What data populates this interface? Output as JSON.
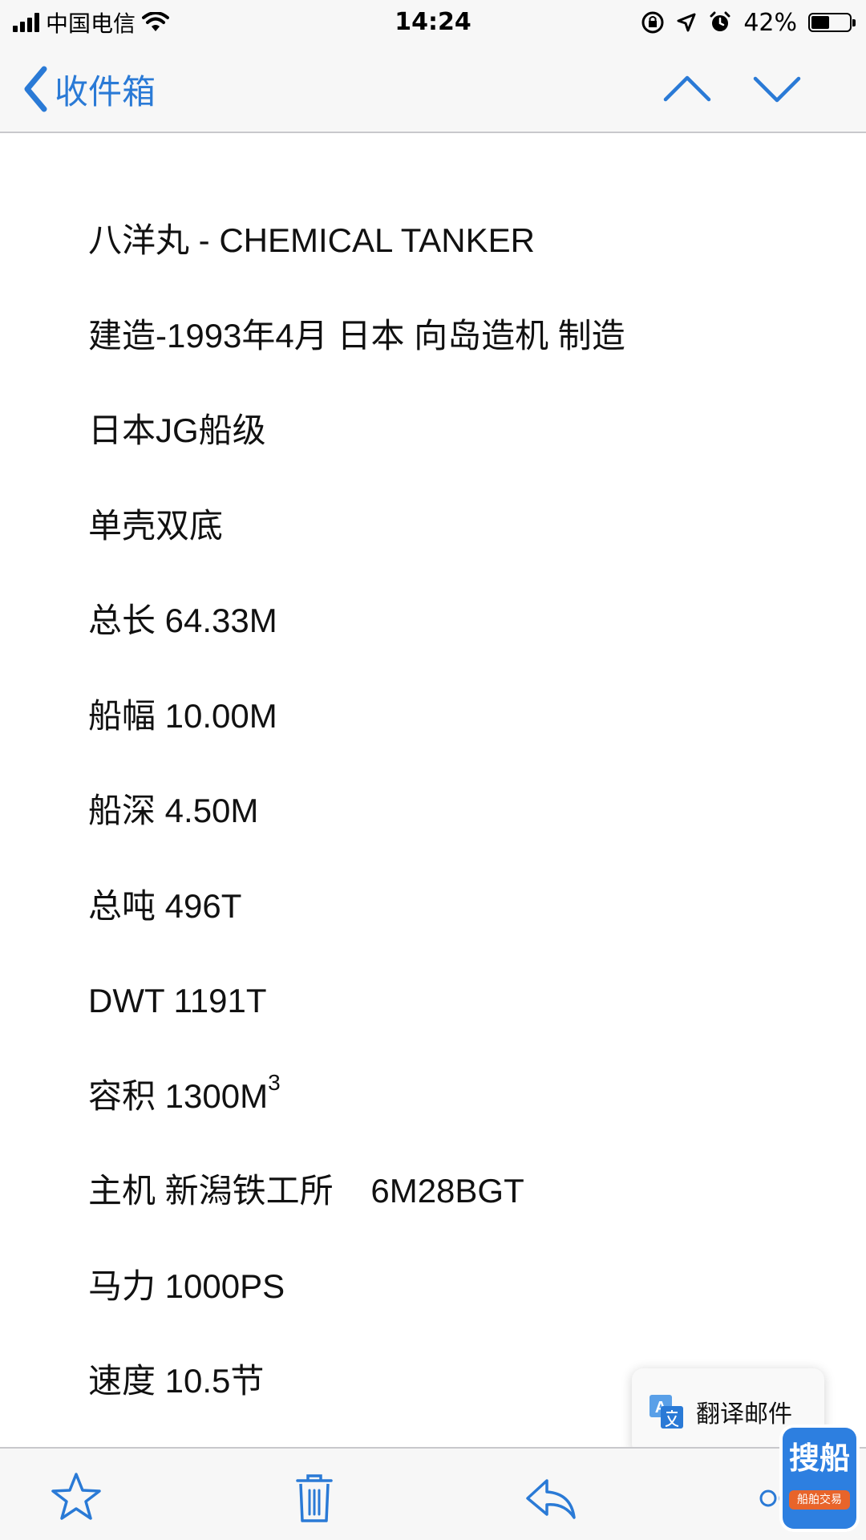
{
  "status_bar": {
    "carrier": "中国电信",
    "time": "14:24",
    "battery": "42%",
    "battery_level": 0.42,
    "icons": [
      "signal-icon",
      "wifi-icon",
      "orientation-lock-icon",
      "location-icon",
      "alarm-icon",
      "battery-icon"
    ]
  },
  "nav": {
    "back_label": "收件箱",
    "icons": [
      "chevron-left-icon",
      "chevron-up-icon",
      "chevron-down-icon"
    ],
    "accent_color": "#2a7ad6"
  },
  "body": {
    "lines": [
      "八洋丸 - CHEMICAL TANKER",
      "建造-1993年4月 日本 向岛造机 制造",
      "日本JG船级",
      "单壳双底",
      "总长 64.33M",
      "船幅 10.00M",
      "船深 4.50M",
      "总吨 496T",
      "DWT 1191T",
      "容积 1300M",
      "主机 新潟铁工所    6M28BGT",
      "马力 1000PS",
      "速度 10.5节"
    ],
    "volume_superscript": "3"
  },
  "translate_popup": {
    "label": "翻译邮件",
    "icon": "translate-icon"
  },
  "toolbar": {
    "icons": [
      "star-icon",
      "trash-icon",
      "reply-icon",
      "more-icon"
    ]
  },
  "watermark": {
    "main": "搜船",
    "sub": "船舶交易"
  }
}
